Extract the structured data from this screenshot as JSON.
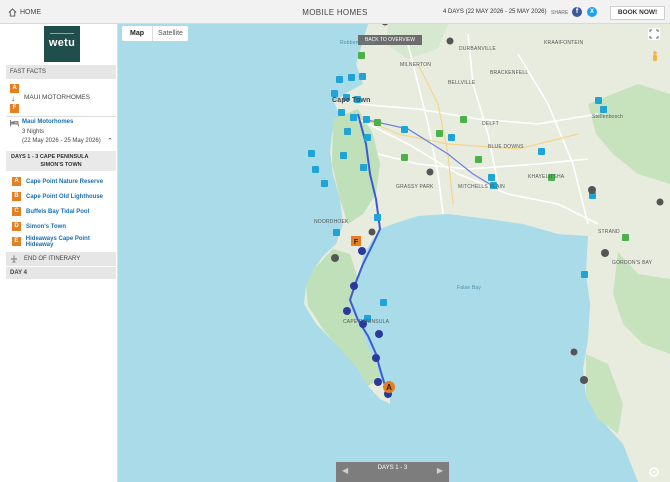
{
  "header": {
    "home_label": "HOME",
    "title": "MOBILE HOMES",
    "dates": "4 DAYS (22 MAY 2026 - 25 MAY 2026)",
    "share_label": "SHARE",
    "facebook": "f",
    "x": "X",
    "book_label": "BOOK NOW!"
  },
  "sidebar": {
    "logo": "wetu",
    "fast_facts": "FAST FACTS",
    "pins": [
      "A",
      "F"
    ],
    "route_label": "MAUI MOTORHOMES",
    "accommodation": {
      "name": "Maui Motorhomes",
      "nights": "3 Nights",
      "dates": "(22 May 2026 - 25 May 2026)"
    },
    "day_block": {
      "line1": "DAYS 1 - 3  CAPE PENINSULA",
      "line2": "SIMON'S TOWN"
    },
    "stops": [
      {
        "letter": "A",
        "name": "Cape Point Nature Reserve"
      },
      {
        "letter": "B",
        "name": "Cape Point Old Lighthouse"
      },
      {
        "letter": "C",
        "name": "Buffels Bay Tidal Pool"
      },
      {
        "letter": "D",
        "name": "Simon's Town"
      },
      {
        "letter": "E",
        "name": "Hideaways Cape Point Hideaway"
      }
    ],
    "end_label": "END OF ITINERARY",
    "day4": "DAY 4"
  },
  "map": {
    "tabs": [
      "Map",
      "Satellite"
    ],
    "overview": "BACK TO OVERVIEW",
    "nav_days": "DAYS 1 - 3",
    "labels": {
      "durbanville": "DURBANVILLE",
      "milnerton": "MILNERTON",
      "brackenfell": "BRACKENFELL",
      "bellville": "BELLVILLE",
      "kraaifontein": "KRAAIFONTEIN",
      "cape_town": "Cape Town",
      "stellenbosch": "Stellenbosch",
      "delft": "DELFT",
      "blue_downs": "BLUE DOWNS",
      "grassy_park": "GRASSY PARK",
      "mitchells_plain": "MITCHELLS PLAIN",
      "strand": "STRAND",
      "gordons_bay": "GORDON'S BAY",
      "noordhoek": "NOORDHOEK",
      "cape_peninsula": "CAPE PENINSULA",
      "false_bay": "False Bay",
      "robben_island": "Robben Island",
      "khayelitsha": "KHAYELITSHA"
    },
    "colors": {
      "water": "#a9dbe9",
      "land": "#e8ecdf",
      "park": "#bfe0b8",
      "route": "#3b5bd6",
      "marker": "#1fa4d8",
      "pin": "#e67e22"
    }
  }
}
